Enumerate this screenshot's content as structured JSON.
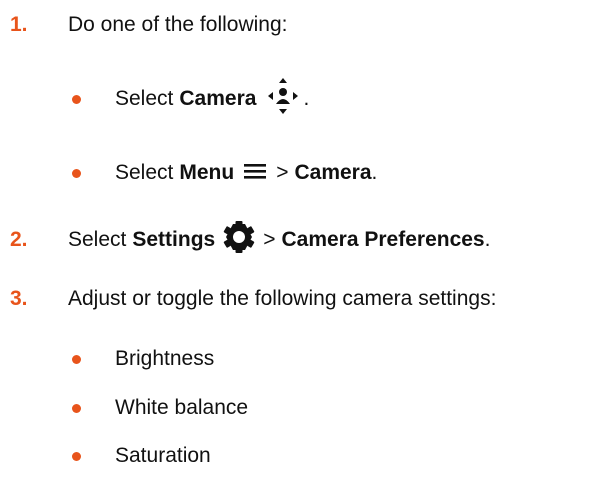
{
  "steps": [
    {
      "number": "1.",
      "text": "Do one of the following:",
      "options": [
        {
          "prefix": "Select",
          "target": "Camera",
          "icon": "camera-control-icon",
          "suffix": "."
        },
        {
          "prefix": "Select",
          "target": "Menu",
          "icon": "hamburger-menu-icon",
          "separator": ">",
          "target2": "Camera",
          "suffix": "."
        }
      ]
    },
    {
      "number": "2.",
      "prefix": "Select",
      "target": "Settings",
      "icon": "gear-icon",
      "separator": ">",
      "target2": "Camera Preferences",
      "suffix": "."
    },
    {
      "number": "3.",
      "text": "Adjust or toggle the following camera settings:",
      "items": [
        "Brightness",
        "White balance",
        "Saturation"
      ]
    }
  ],
  "colors": {
    "accent": "#e8541b",
    "text": "#111111"
  }
}
